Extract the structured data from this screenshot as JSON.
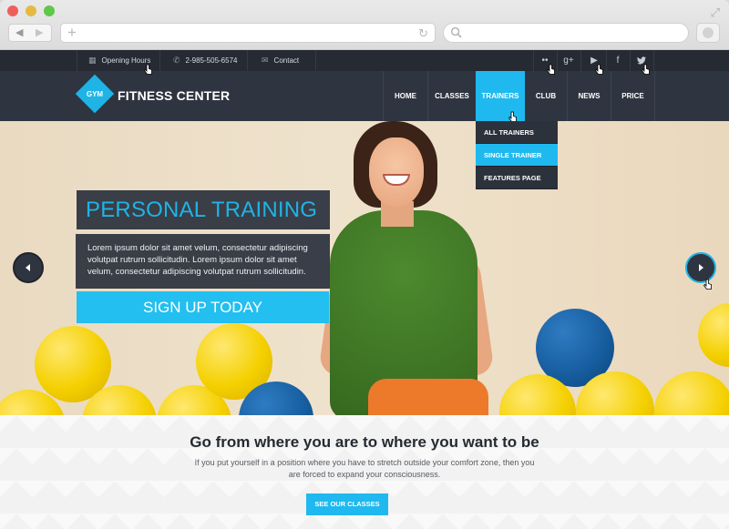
{
  "topbar": {
    "opening_hours": "Opening Hours",
    "phone": "2-985-505-6574",
    "contact": "Contact",
    "social": [
      {
        "icon": "flickr-icon",
        "glyph": "••"
      },
      {
        "icon": "google-plus-icon",
        "glyph": "g+"
      },
      {
        "icon": "youtube-icon",
        "glyph": "▶"
      },
      {
        "icon": "facebook-icon",
        "glyph": "f"
      },
      {
        "icon": "twitter-icon",
        "glyph": "🐦"
      }
    ]
  },
  "header": {
    "logo_badge": "GYM",
    "brand": "FITNESS CENTER",
    "menu": {
      "home": "HOME",
      "classes": "CLASSES",
      "trainers": "TRAINERS",
      "club": "CLUB",
      "news": "NEWS",
      "price": "PRICE"
    },
    "active_menu": "TRAINERS",
    "dropdown": {
      "all_trainers": "ALL TRAINERS",
      "single_trainer": "SINGLE TRAINER",
      "features_page": "FEATURES PAGE"
    }
  },
  "hero": {
    "title": "PERSONAL TRAINING",
    "text": "Lorem ipsum dolor sit amet velum, consectetur adipiscing volutpat rutrum sollicitudin. Lorem ipsum dolor sit amet velum, consectetur adipiscing volutpat rutrum sollicitudin.",
    "cta": "SIGN UP TODAY"
  },
  "section": {
    "headline": "Go from where you are to where you want to be",
    "subtext": "If you put yourself in a position where you have to stretch outside your comfort zone, then you are forced to expand your consciousness.",
    "cta": "SEE OUR CLASSES"
  },
  "colors": {
    "accent": "#1fb9ef",
    "header_bg": "#2f3540",
    "topbar_bg": "#262b33"
  }
}
